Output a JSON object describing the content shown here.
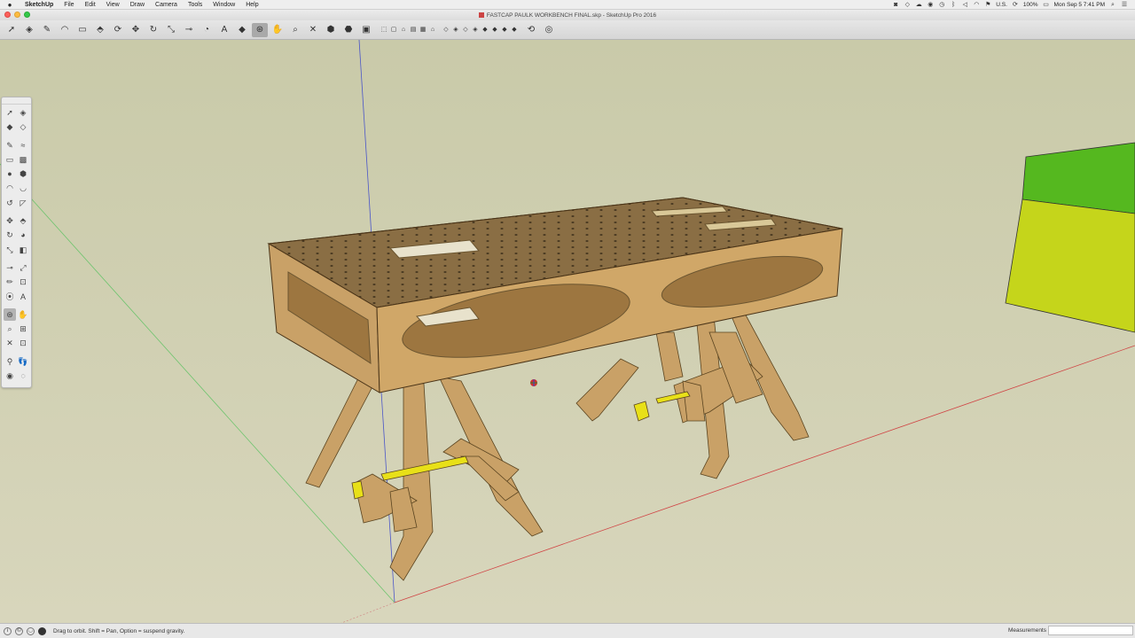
{
  "menubar": {
    "apple_icon": "apple-icon",
    "app_name": "SketchUp",
    "items": [
      "File",
      "Edit",
      "View",
      "Draw",
      "Camera",
      "Tools",
      "Window",
      "Help"
    ],
    "battery": "100%",
    "language": "U.S.",
    "clock": "Mon Sep 5  7:41 PM"
  },
  "window": {
    "title": "FASTCAP PAULK WORKBENCH FINAL.skp - SketchUp Pro 2016"
  },
  "toolbar": {
    "tools": [
      {
        "name": "select-tool",
        "glyph": "➚"
      },
      {
        "name": "eraser-tool",
        "glyph": "◈"
      },
      {
        "name": "pencil-line-tool",
        "glyph": "✎"
      },
      {
        "name": "arc-tool",
        "glyph": "◠"
      },
      {
        "name": "rectangle-tool",
        "glyph": "▭"
      },
      {
        "name": "push-pull-tool",
        "glyph": "⬘"
      },
      {
        "name": "offset-tool",
        "glyph": "⟳"
      },
      {
        "name": "move-tool",
        "glyph": "✥"
      },
      {
        "name": "rotate-tool",
        "glyph": "↻"
      },
      {
        "name": "scale-tool",
        "glyph": "⤡"
      },
      {
        "name": "tape-measure-tool",
        "glyph": "⊸"
      },
      {
        "name": "protractor-tool",
        "glyph": "◔"
      },
      {
        "name": "text-tool",
        "glyph": "A"
      },
      {
        "name": "paint-bucket-tool",
        "glyph": "◆"
      },
      {
        "name": "orbit-tool",
        "glyph": "⊛"
      },
      {
        "name": "pan-tool",
        "glyph": "✋"
      },
      {
        "name": "zoom-tool",
        "glyph": "⌕"
      },
      {
        "name": "zoom-extents-tool",
        "glyph": "✕"
      },
      {
        "name": "warehouse-tool",
        "glyph": "⬢"
      },
      {
        "name": "extension-warehouse-tool",
        "glyph": "⬣"
      },
      {
        "name": "layout-tool",
        "glyph": "▣"
      }
    ],
    "view_icons": [
      "⬚",
      "▢",
      "⌂",
      "▤",
      "▦",
      "⌂"
    ],
    "style_icons": [
      "◇",
      "◈",
      "◇",
      "◈",
      "◆",
      "◆",
      "◆",
      "◆"
    ],
    "extra_icons": [
      "⟲",
      "◎"
    ]
  },
  "palette": {
    "rows": [
      [
        "➚",
        "◈"
      ],
      [
        "◆",
        "◇"
      ],
      [
        "✎",
        "≈"
      ],
      [
        "▭",
        "▩"
      ],
      [
        "●",
        "⬢"
      ],
      [
        "◠",
        "◡"
      ],
      [
        "↺",
        "◸"
      ],
      [
        "✥",
        "⬘"
      ],
      [
        "↻",
        "◕"
      ],
      [
        "⤡",
        "◧"
      ],
      [
        "⊸",
        "⤢"
      ],
      [
        "✏",
        "⊡"
      ],
      [
        "⦿",
        "A"
      ],
      [
        "⊛",
        "✋"
      ],
      [
        "⌕",
        "⊞"
      ],
      [
        "✕",
        "⊡"
      ],
      [
        "⚲",
        "👣"
      ],
      [
        "◉",
        "◌"
      ]
    ]
  },
  "statusbar": {
    "hint": "Drag to orbit. Shift = Pan, Option = suspend gravity.",
    "measurements_label": "Measurements"
  },
  "colors": {
    "sky": "#c9caa9",
    "ground": "#d6d4b8",
    "wood": "#c9a167",
    "wood_dark": "#a57d45",
    "top_surface": "#8a6e44",
    "box_top": "#54b61e",
    "box_front": "#c4d61a"
  }
}
